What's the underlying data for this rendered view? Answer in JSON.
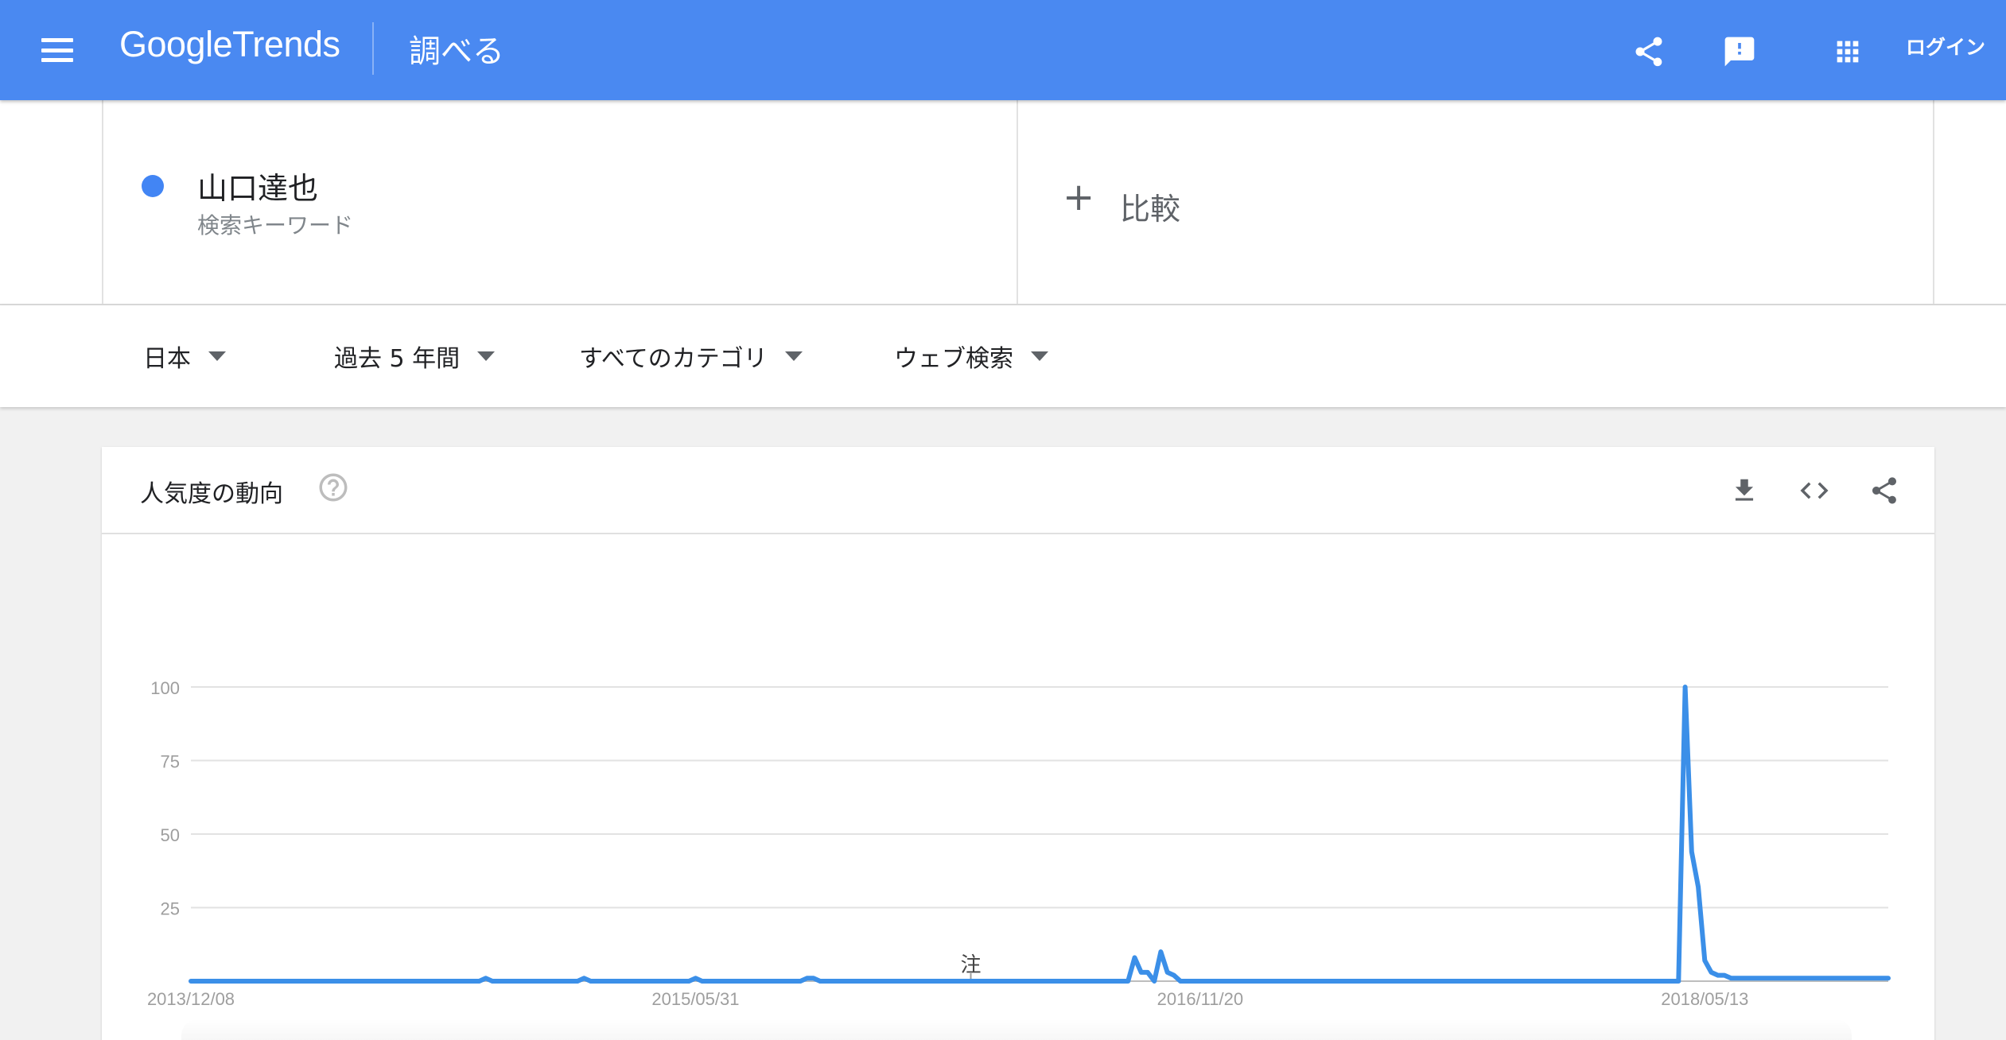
{
  "header": {
    "logo_google": "Google",
    "logo_trends": "Trends",
    "explore_label": "調べる",
    "login_label": "ログイン"
  },
  "search_term": {
    "name": "山口達也",
    "type": "検索キーワード",
    "color": "#4285f4"
  },
  "compare": {
    "label": "比較"
  },
  "filters": [
    {
      "label": "日本"
    },
    {
      "label": "過去 5 年間"
    },
    {
      "label": "すべてのカテゴリ"
    },
    {
      "label": "ウェブ検索"
    }
  ],
  "card": {
    "title": "人気度の動向"
  },
  "chart_data": {
    "type": "line",
    "series": [
      {
        "name": "山口達也",
        "color": "#3b8fe8",
        "points": [
          [
            "2013/12/08",
            0
          ],
          [
            "2014/10/12",
            0
          ],
          [
            "2014/10/19",
            1
          ],
          [
            "2014/10/26",
            0
          ],
          [
            "2015/01/25",
            0
          ],
          [
            "2015/02/01",
            1
          ],
          [
            "2015/02/08",
            0
          ],
          [
            "2015/05/24",
            0
          ],
          [
            "2015/05/31",
            1
          ],
          [
            "2015/06/07",
            0
          ],
          [
            "2015/09/20",
            0
          ],
          [
            "2015/09/27",
            1
          ],
          [
            "2015/10/04",
            1
          ],
          [
            "2015/10/11",
            0
          ],
          [
            "2016/09/04",
            0
          ],
          [
            "2016/09/11",
            8
          ],
          [
            "2016/09/18",
            3
          ],
          [
            "2016/09/25",
            3
          ],
          [
            "2016/10/02",
            0
          ],
          [
            "2016/10/09",
            10
          ],
          [
            "2016/10/16",
            3
          ],
          [
            "2016/10/23",
            2
          ],
          [
            "2016/10/30",
            0
          ],
          [
            "2018/04/15",
            0
          ],
          [
            "2018/04/22",
            100
          ],
          [
            "2018/04/29",
            44
          ],
          [
            "2018/05/06",
            32
          ],
          [
            "2018/05/13",
            7
          ],
          [
            "2018/05/20",
            3
          ],
          [
            "2018/05/27",
            2
          ],
          [
            "2018/06/03",
            2
          ],
          [
            "2018/06/10",
            1
          ],
          [
            "2018/11/25",
            1
          ]
        ]
      }
    ],
    "x_ticks": [
      "2013/12/08",
      "2015/05/31",
      "2016/11/20",
      "2018/05/13"
    ],
    "y_ticks": [
      25,
      50,
      75,
      100
    ],
    "ylim": [
      0,
      100
    ],
    "grid": true,
    "annotations": [
      {
        "text": "注",
        "x": "2016/03/20"
      }
    ]
  }
}
